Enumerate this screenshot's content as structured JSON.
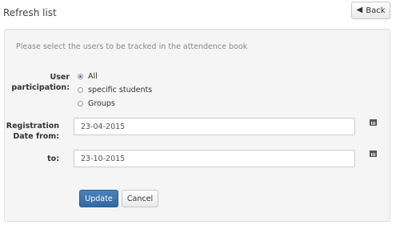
{
  "header": {
    "title": "Refresh list",
    "back_label": "Back",
    "back_icon": "arrow-left-icon"
  },
  "form": {
    "instruction": "Please select the users to be tracked in the attendence book",
    "participation_label": "User participation:",
    "participation_options": [
      {
        "label": "All",
        "selected": true
      },
      {
        "label": "specific students",
        "selected": false
      },
      {
        "label": "Groups",
        "selected": false
      }
    ],
    "date_from_label": "Registration Date from:",
    "date_from_value": "23-04-2015",
    "date_to_label": "to:",
    "date_to_value": "23-10-2015",
    "calendar_icon": "calendar-icon",
    "update_label": "Update",
    "cancel_label": "Cancel"
  },
  "colors": {
    "primary_button": "#33689f",
    "panel_background": "#f5f5f5"
  }
}
